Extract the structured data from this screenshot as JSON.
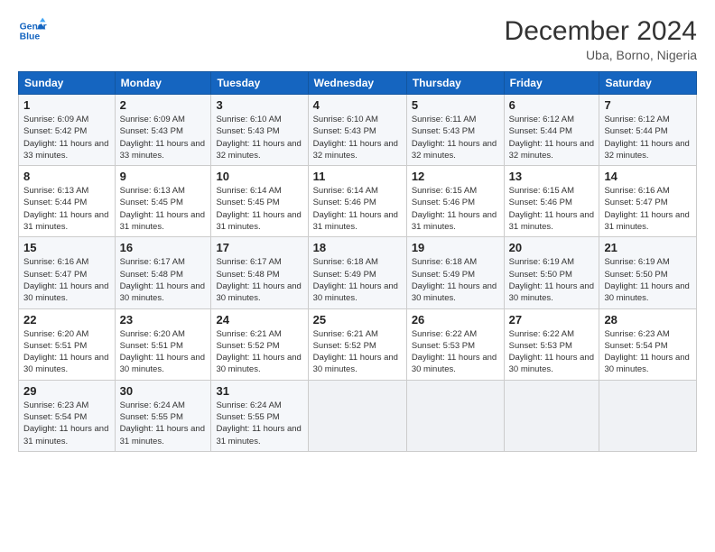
{
  "header": {
    "logo_line1": "General",
    "logo_line2": "Blue",
    "title": "December 2024",
    "subtitle": "Uba, Borno, Nigeria"
  },
  "days_of_week": [
    "Sunday",
    "Monday",
    "Tuesday",
    "Wednesday",
    "Thursday",
    "Friday",
    "Saturday"
  ],
  "weeks": [
    [
      {
        "day": "1",
        "sunrise": "6:09 AM",
        "sunset": "5:42 PM",
        "daylight": "11 hours and 33 minutes."
      },
      {
        "day": "2",
        "sunrise": "6:09 AM",
        "sunset": "5:43 PM",
        "daylight": "11 hours and 33 minutes."
      },
      {
        "day": "3",
        "sunrise": "6:10 AM",
        "sunset": "5:43 PM",
        "daylight": "11 hours and 32 minutes."
      },
      {
        "day": "4",
        "sunrise": "6:10 AM",
        "sunset": "5:43 PM",
        "daylight": "11 hours and 32 minutes."
      },
      {
        "day": "5",
        "sunrise": "6:11 AM",
        "sunset": "5:43 PM",
        "daylight": "11 hours and 32 minutes."
      },
      {
        "day": "6",
        "sunrise": "6:12 AM",
        "sunset": "5:44 PM",
        "daylight": "11 hours and 32 minutes."
      },
      {
        "day": "7",
        "sunrise": "6:12 AM",
        "sunset": "5:44 PM",
        "daylight": "11 hours and 32 minutes."
      }
    ],
    [
      {
        "day": "8",
        "sunrise": "6:13 AM",
        "sunset": "5:44 PM",
        "daylight": "11 hours and 31 minutes."
      },
      {
        "day": "9",
        "sunrise": "6:13 AM",
        "sunset": "5:45 PM",
        "daylight": "11 hours and 31 minutes."
      },
      {
        "day": "10",
        "sunrise": "6:14 AM",
        "sunset": "5:45 PM",
        "daylight": "11 hours and 31 minutes."
      },
      {
        "day": "11",
        "sunrise": "6:14 AM",
        "sunset": "5:46 PM",
        "daylight": "11 hours and 31 minutes."
      },
      {
        "day": "12",
        "sunrise": "6:15 AM",
        "sunset": "5:46 PM",
        "daylight": "11 hours and 31 minutes."
      },
      {
        "day": "13",
        "sunrise": "6:15 AM",
        "sunset": "5:46 PM",
        "daylight": "11 hours and 31 minutes."
      },
      {
        "day": "14",
        "sunrise": "6:16 AM",
        "sunset": "5:47 PM",
        "daylight": "11 hours and 31 minutes."
      }
    ],
    [
      {
        "day": "15",
        "sunrise": "6:16 AM",
        "sunset": "5:47 PM",
        "daylight": "11 hours and 30 minutes."
      },
      {
        "day": "16",
        "sunrise": "6:17 AM",
        "sunset": "5:48 PM",
        "daylight": "11 hours and 30 minutes."
      },
      {
        "day": "17",
        "sunrise": "6:17 AM",
        "sunset": "5:48 PM",
        "daylight": "11 hours and 30 minutes."
      },
      {
        "day": "18",
        "sunrise": "6:18 AM",
        "sunset": "5:49 PM",
        "daylight": "11 hours and 30 minutes."
      },
      {
        "day": "19",
        "sunrise": "6:18 AM",
        "sunset": "5:49 PM",
        "daylight": "11 hours and 30 minutes."
      },
      {
        "day": "20",
        "sunrise": "6:19 AM",
        "sunset": "5:50 PM",
        "daylight": "11 hours and 30 minutes."
      },
      {
        "day": "21",
        "sunrise": "6:19 AM",
        "sunset": "5:50 PM",
        "daylight": "11 hours and 30 minutes."
      }
    ],
    [
      {
        "day": "22",
        "sunrise": "6:20 AM",
        "sunset": "5:51 PM",
        "daylight": "11 hours and 30 minutes."
      },
      {
        "day": "23",
        "sunrise": "6:20 AM",
        "sunset": "5:51 PM",
        "daylight": "11 hours and 30 minutes."
      },
      {
        "day": "24",
        "sunrise": "6:21 AM",
        "sunset": "5:52 PM",
        "daylight": "11 hours and 30 minutes."
      },
      {
        "day": "25",
        "sunrise": "6:21 AM",
        "sunset": "5:52 PM",
        "daylight": "11 hours and 30 minutes."
      },
      {
        "day": "26",
        "sunrise": "6:22 AM",
        "sunset": "5:53 PM",
        "daylight": "11 hours and 30 minutes."
      },
      {
        "day": "27",
        "sunrise": "6:22 AM",
        "sunset": "5:53 PM",
        "daylight": "11 hours and 30 minutes."
      },
      {
        "day": "28",
        "sunrise": "6:23 AM",
        "sunset": "5:54 PM",
        "daylight": "11 hours and 30 minutes."
      }
    ],
    [
      {
        "day": "29",
        "sunrise": "6:23 AM",
        "sunset": "5:54 PM",
        "daylight": "11 hours and 31 minutes."
      },
      {
        "day": "30",
        "sunrise": "6:24 AM",
        "sunset": "5:55 PM",
        "daylight": "11 hours and 31 minutes."
      },
      {
        "day": "31",
        "sunrise": "6:24 AM",
        "sunset": "5:55 PM",
        "daylight": "11 hours and 31 minutes."
      },
      null,
      null,
      null,
      null
    ]
  ]
}
